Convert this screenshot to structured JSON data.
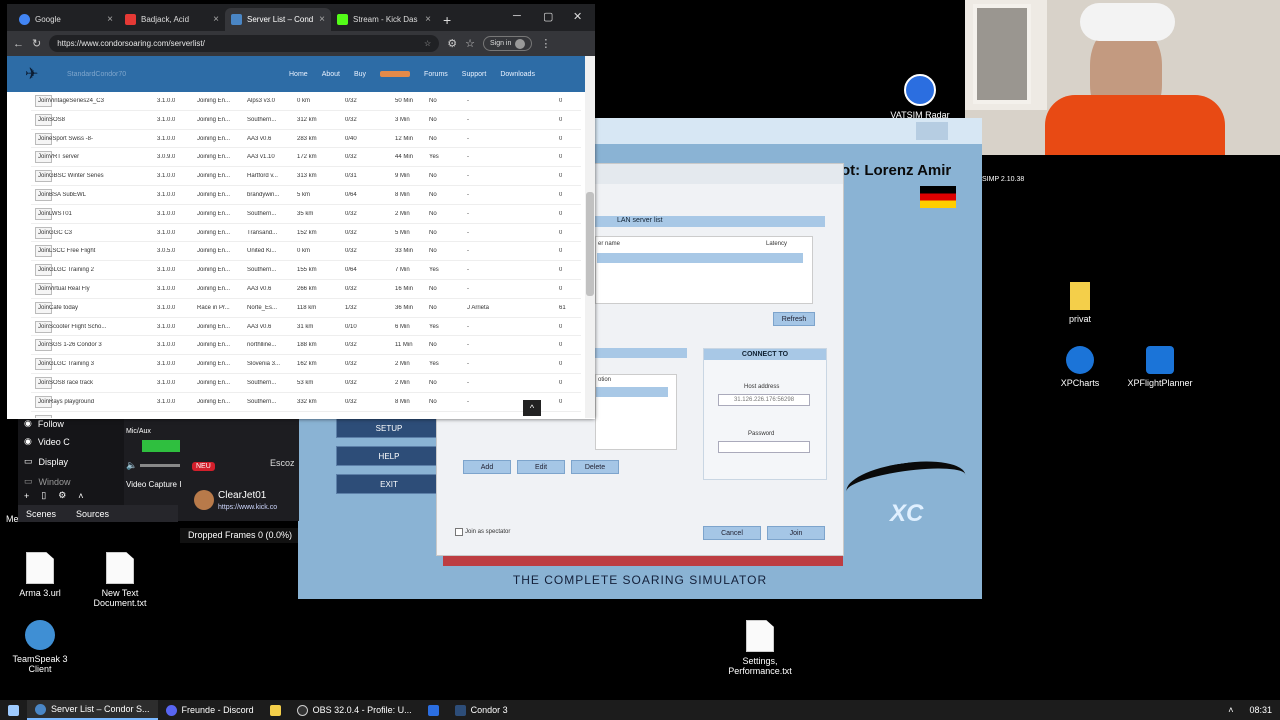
{
  "browser": {
    "tabs": [
      {
        "title": "Google",
        "icon_color": "#4285f4"
      },
      {
        "title": "Badjack, Acid",
        "icon_color": "#e53935"
      },
      {
        "title": "Server List – Cond",
        "icon_color": "#4a86c5"
      },
      {
        "title": "Stream - Kick Das",
        "icon_color": "#53fc18"
      }
    ],
    "url": "https://www.condorsoaring.com/serverlist/",
    "signin_label": "Sign in",
    "nav": [
      "Home",
      "About",
      "Buy",
      "Forums",
      "Support",
      "Downloads"
    ],
    "header_cols": [
      "StandardCondor70",
      "3.1.0.0",
      "Joining En...",
      "Germany..."
    ],
    "rows": [
      {
        "name": "VintageSeries24_C3",
        "ver": "3.1.0.0",
        "status": "Joining En...",
        "scenery": "Alps3 v3.0",
        "dist": "0 km",
        "players": "0/32",
        "time": "50 Min",
        "pwd": "No",
        "club": "-",
        "n": "0"
      },
      {
        "name": "SOS8",
        "ver": "3.1.0.0",
        "status": "Joining En...",
        "scenery": "Southern...",
        "dist": "312 km",
        "players": "0/32",
        "time": "3 Min",
        "pwd": "No",
        "club": "-",
        "n": "0"
      },
      {
        "name": "eSport Swiss -8-",
        "ver": "3.1.0.0",
        "status": "Joining En...",
        "scenery": "AA3 v0.6",
        "dist": "283 km",
        "players": "0/40",
        "time": "12 Min",
        "pwd": "No",
        "club": "-",
        "n": "0"
      },
      {
        "name": "VRT server",
        "ver": "3.0.9.0",
        "status": "Joining En...",
        "scenery": "AA3 v1.10",
        "dist": "172 km",
        "players": "0/32",
        "time": "44 Min",
        "pwd": "Yes",
        "club": "-",
        "n": "0"
      },
      {
        "name": "GBSC Winter Series",
        "ver": "3.1.0.0",
        "status": "Joining En...",
        "scenery": "Hartford v...",
        "dist": "313 km",
        "players": "0/31",
        "time": "9 Min",
        "pwd": "No",
        "club": "-",
        "n": "0"
      },
      {
        "name": "BSA SubEWL",
        "ver": "3.1.0.0",
        "status": "Joining En...",
        "scenery": "brandywin...",
        "dist": "5 km",
        "players": "0/64",
        "time": "8 Min",
        "pwd": "No",
        "club": "-",
        "n": "0"
      },
      {
        "name": "LWST01",
        "ver": "3.1.0.0",
        "status": "Joining En...",
        "scenery": "Southern...",
        "dist": "35 km",
        "players": "0/32",
        "time": "2 Min",
        "pwd": "No",
        "club": "-",
        "n": "0"
      },
      {
        "name": "GGC C3",
        "ver": "3.1.0.0",
        "status": "Joining En...",
        "scenery": "Transand...",
        "dist": "152 km",
        "players": "0/32",
        "time": "5 Min",
        "pwd": "No",
        "club": "-",
        "n": "0"
      },
      {
        "name": "LSCC Free Flight",
        "ver": "3.0.5.0",
        "status": "Joining En...",
        "scenery": "United Ki...",
        "dist": "0 km",
        "players": "0/32",
        "time": "33 Min",
        "pwd": "No",
        "club": "-",
        "n": "0"
      },
      {
        "name": "GLGC Training 2",
        "ver": "3.1.0.0",
        "status": "Joining En...",
        "scenery": "Southern...",
        "dist": "155 km",
        "players": "0/64",
        "time": "7 Min",
        "pwd": "Yes",
        "club": "-",
        "n": "0"
      },
      {
        "name": "Virtual Real Fly",
        "ver": "3.1.0.0",
        "status": "Joining En...",
        "scenery": "AA3 v0.6",
        "dist": "266 km",
        "players": "0/32",
        "time": "16 Min",
        "pwd": "No",
        "club": "-",
        "n": "0"
      },
      {
        "name": "Cafe today",
        "ver": "3.1.0.0",
        "status": "Race in Pr...",
        "scenery": "Norte_Es...",
        "dist": "118 km",
        "players": "1/32",
        "time": "36 Min",
        "pwd": "No",
        "club": "J Arrieta",
        "n": "61"
      },
      {
        "name": "Scooter Flight Scho...",
        "ver": "3.1.0.0",
        "status": "Joining En...",
        "scenery": "AA3 v0.6",
        "dist": "31 km",
        "players": "0/10",
        "time": "6 Min",
        "pwd": "Yes",
        "club": "-",
        "n": "0"
      },
      {
        "name": "SGS 1-26 Condor 3",
        "ver": "3.1.0.0",
        "status": "Joining En...",
        "scenery": "northlline...",
        "dist": "188 km",
        "players": "0/32",
        "time": "11 Min",
        "pwd": "No",
        "club": "-",
        "n": "0"
      },
      {
        "name": "GLGC Training 3",
        "ver": "3.1.0.0",
        "status": "Joining En...",
        "scenery": "Slovenia 3...",
        "dist": "162 km",
        "players": "0/32",
        "time": "2 Min",
        "pwd": "Yes",
        "club": "-",
        "n": "0"
      },
      {
        "name": "SOS8 race track",
        "ver": "3.1.0.0",
        "status": "Joining En...",
        "scenery": "Southern...",
        "dist": "53 km",
        "players": "0/32",
        "time": "2 Min",
        "pwd": "No",
        "club": "-",
        "n": "0"
      },
      {
        "name": "Rays playground",
        "ver": "3.1.0.0",
        "status": "Joining En...",
        "scenery": "Southern...",
        "dist": "332 km",
        "players": "0/32",
        "time": "8 Min",
        "pwd": "No",
        "club": "-",
        "n": "0"
      },
      {
        "name": "L&P Condor3 Server",
        "ver": "3.0.9.0",
        "status": "Joining En...",
        "scenery": "Centre_It...",
        "dist": "126 km",
        "players": "0/32",
        "time": "2 Min",
        "pwd": "Yes",
        "club": "-",
        "n": "0"
      }
    ],
    "join_label": "Join"
  },
  "condor": {
    "pilot": "ot: Lorenz Amir",
    "tagline": "THE COMPLETE SOARING SIMULATOR",
    "menu": [
      "SETUP",
      "HELP",
      "EXIT"
    ],
    "xc": "XC",
    "dialog": {
      "lan_title": "LAN server list",
      "col_name": "er name",
      "col_latency": "Latency",
      "refresh": "Refresh",
      "connect_title": "CONNECT TO",
      "host_label": "Host address",
      "host_value": "31.126.226.176:56298",
      "password_label": "Password",
      "option_label": "otion",
      "add": "Add",
      "edit": "Edit",
      "delete": "Delete",
      "spectator": "Join as spectator",
      "cancel": "Cancel",
      "join": "Join"
    }
  },
  "obs": {
    "sources": [
      "Follow",
      "Video C",
      "Display",
      "Window"
    ],
    "mixer_label": "Mic/Aux",
    "video_capture": "Video Capture I",
    "scenes": "Scenes",
    "sources_tab": "Sources",
    "dropped": "Dropped Frames 0 (0.0%)",
    "chat_user": "ClearJet01",
    "chat_link": "https://www.kick.co",
    "badge": "NEU",
    "me": "Me",
    "esco": "Escoz"
  },
  "desktop": {
    "icons": [
      {
        "label": "VATSIM Radar"
      },
      {
        "label": "privat"
      },
      {
        "label": "XPCharts"
      },
      {
        "label": "XPFlightPlanner"
      },
      {
        "label": "Arma 3.url"
      },
      {
        "label": "New Text Document.txt"
      },
      {
        "label": "TeamSpeak 3 Client"
      },
      {
        "label": "Settings, Performance.txt"
      }
    ],
    "simp": "SIMP 2.10.38"
  },
  "taskbar": {
    "items": [
      "Server List – Condor S...",
      "Freunde - Discord",
      "OBS 32.0.4 - Profile: U...",
      "Condor 3"
    ],
    "time": "08:31"
  }
}
